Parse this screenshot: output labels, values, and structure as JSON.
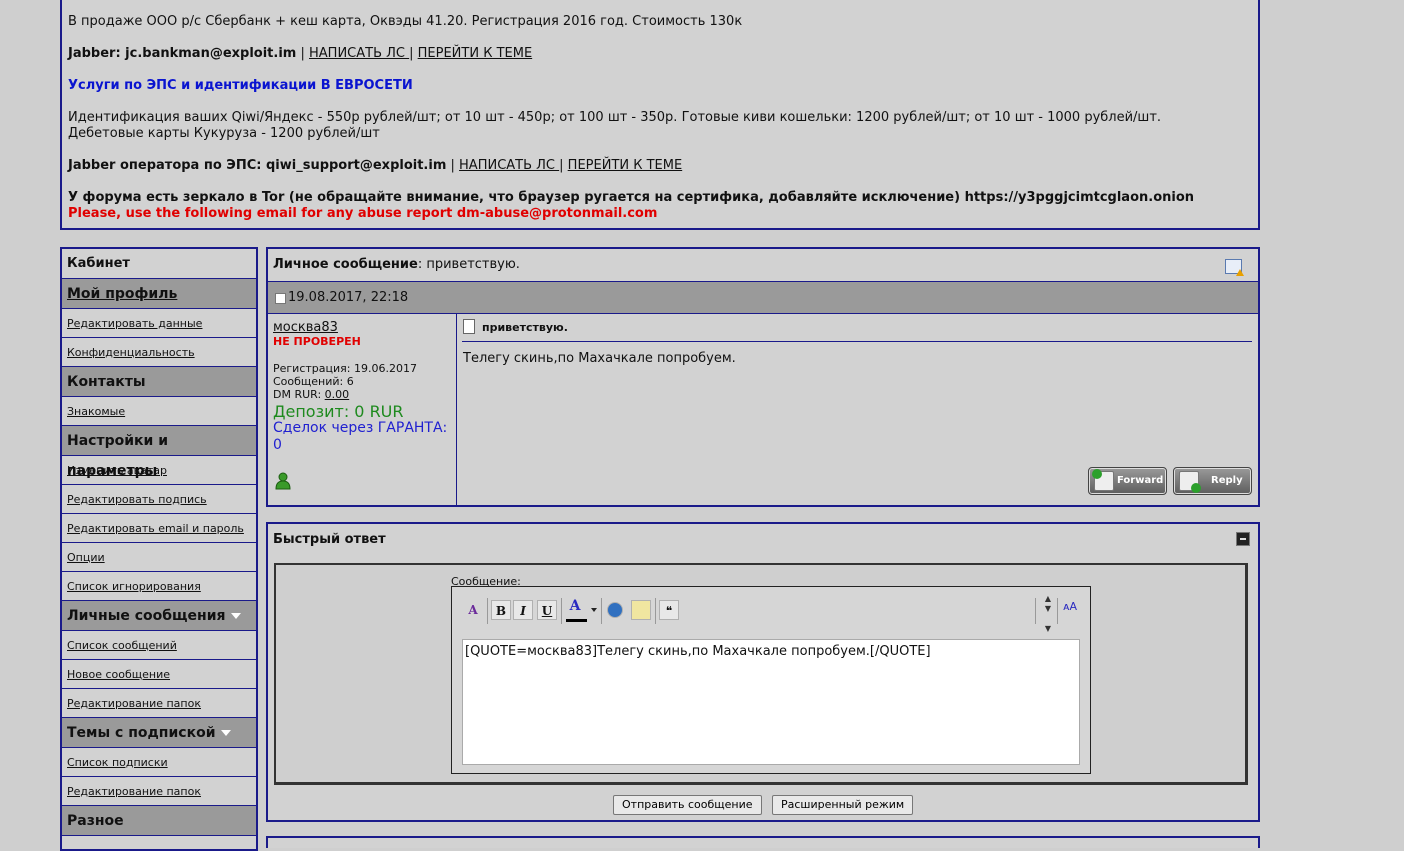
{
  "notice": {
    "line1": "В продаже ООО р/с Сбербанк + кеш карта, Оквэды 41.20. Регистрация 2016 год. Стоимость 130к",
    "jabber1_label": "Jabber: jc.bankman@exploit.im",
    "jabber1_sep": " | ",
    "write_pm": "НАПИСАТЬ ЛС ",
    "goto_topic": "ПЕРЕЙТИ К ТЕМЕ",
    "eps_title": "Услуги по ЭПС и идентификации В ЕВРОСЕТИ",
    "eps_line1": "Идентификация ваших Qiwi/Яндекс - 550р рублей/шт; от 10 шт - 450р; от 100 шт - 350р. Готовые киви кошельки: 1200 рублей/шт; от 10 шт - 1000 рублей/шт.",
    "eps_line2": "Дебетовые карты Кукуруза - 1200 рублей/шт",
    "jabber2_label": "Jabber оператора по ЭПС: qiwi_support@exploit.im",
    "mirror": "У форума есть зеркало в Tor (не обращайте внимание, что браузер ругается на сертифика, добавляйте исключение) https://y3pggjcimtcglaon.onion",
    "abuse": "Please, use the following email for any abuse report dm-abuse@protonmail.com"
  },
  "sidebar": {
    "cabinet": "Кабинет",
    "my_profile": "Мой профиль",
    "edit_data": "Редактировать данные",
    "privacy": "Конфиденциальность",
    "contacts": "Контакты",
    "friends": "Знакомые",
    "settings": "Настройки и параметры",
    "change_avatar": "Изменить аватар",
    "edit_signature": "Редактировать подпись",
    "edit_email": "Редактировать email и пароль",
    "options": "Опции",
    "ignore_list": "Список игнорирования",
    "private_messages": "Личные сообщения",
    "message_list": "Список сообщений",
    "new_message": "Новое сообщение",
    "edit_folders": "Редактирование папок",
    "subscribed_topics": "Темы с подпиской",
    "subscription_list": "Список подписки",
    "edit_folders2": "Редактирование папок",
    "misc": "Разное"
  },
  "message": {
    "title_label": "Личное сообщение",
    "title_value": ": приветствую.",
    "date": "19.08.2017, 22:18",
    "author": "москва83",
    "status": "НЕ ПРОВЕРЕН",
    "registration": "Регистрация: 19.06.2017",
    "posts": "Сообщений: 6",
    "dm_label": "DM RUR: ",
    "dm_value": "0.00",
    "deposit": "Депозит: 0 RUR",
    "deals": "Сделок через ГАРАНТА: 0",
    "subject": "приветствую.",
    "body": "Телегу скинь,по Махачкале попробуем.",
    "forward": "Forward",
    "reply": "Reply"
  },
  "quick_reply": {
    "title": "Быстрый ответ",
    "label": "Сообщение:",
    "text": "[QUOTE=москва83]Телегу скинь,по Махачкале  попробуем.[/QUOTE]",
    "send": "Отправить сообщение",
    "advanced": "Расширенный режим"
  },
  "colors": {
    "border": "#1a1a8a",
    "header_gray": "#9a9a9a",
    "warn_red": "#e00000",
    "eps_blue": "#0a14d0",
    "deposit_green": "#1e8a1e"
  }
}
